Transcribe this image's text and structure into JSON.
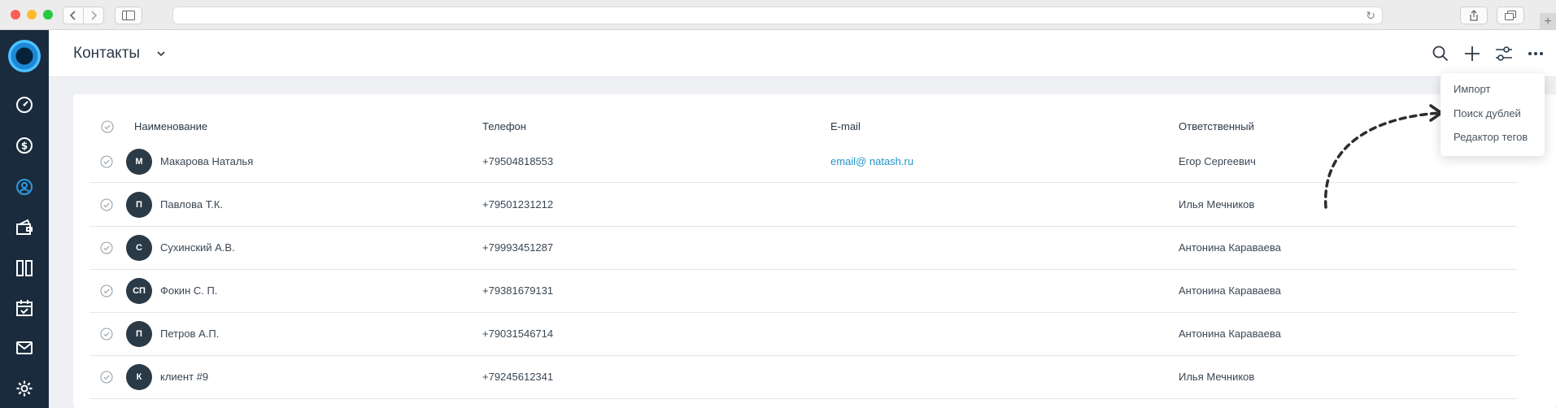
{
  "header": {
    "title": "Контакты"
  },
  "table": {
    "columns": [
      "Наименование",
      "Телефон",
      "E-mail",
      "Ответственный"
    ],
    "rows": [
      {
        "initials": "М",
        "name": "Макарова Наталья",
        "phone": "+79504818553",
        "email": "email@ natash.ru",
        "owner": "Егор Сергеевич"
      },
      {
        "initials": "П",
        "name": "Павлова Т.К.",
        "phone": "+79501231212",
        "email": "",
        "owner": "Илья Мечников"
      },
      {
        "initials": "С",
        "name": "Сухинский А.В.",
        "phone": "+79993451287",
        "email": "",
        "owner": "Антонина Караваева"
      },
      {
        "initials": "СП",
        "name": "Фокин С. П.",
        "phone": "+79381679131",
        "email": "",
        "owner": "Антонина Караваева"
      },
      {
        "initials": "П",
        "name": "Петров А.П.",
        "phone": "+79031546714",
        "email": "",
        "owner": "Антонина Караваева"
      },
      {
        "initials": "К",
        "name": "клиент #9",
        "phone": "+79245612341",
        "email": "",
        "owner": "Илья Мечников"
      }
    ]
  },
  "menu": {
    "items": [
      "Импорт",
      "Поиск дублей",
      "Редактор тегов"
    ]
  },
  "colors": {
    "nav_bg": "#1a2b3d",
    "accent": "#2196c9",
    "avatar_bg": "#2b3a47"
  },
  "icons": {
    "nav": [
      "dashboard-icon",
      "dollar-icon",
      "contacts-icon",
      "deals-icon",
      "kanban-icon",
      "calendar-icon",
      "mail-icon",
      "settings-icon"
    ],
    "toolbar": [
      "search-icon",
      "plus-icon",
      "filter-icon",
      "more-icon"
    ]
  }
}
